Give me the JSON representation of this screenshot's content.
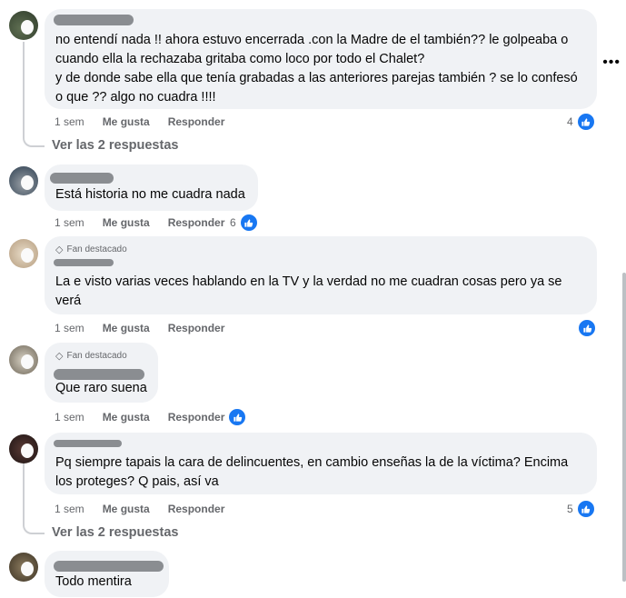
{
  "comments": [
    {
      "badge": "",
      "lines": [
        "no entendí nada !! ahora estuvo encerrada .con la Madre de el también?? le golpeaba o",
        "cuando ella la rechazaba gritaba como loco por todo el Chalet?",
        "y de donde sabe ella que tenía grabadas a las anteriores parejas también ? se lo confesó",
        "o que ?? algo no cuadra !!!!"
      ],
      "time": "1 sem",
      "like": "Me gusta",
      "reply": "Responder",
      "likes": "4",
      "replies": "Ver las 2 respuestas"
    },
    {
      "badge": "",
      "lines": [
        "Está historia no me cuadra nada"
      ],
      "time": "1 sem",
      "like": "Me gusta",
      "reply": "Responder",
      "likes": "6",
      "replies": ""
    },
    {
      "badge": "Fan destacado",
      "lines": [
        "La e visto varias veces hablando en la TV y la verdad no me cuadran cosas pero ya se",
        "verá"
      ],
      "time": "1 sem",
      "like": "Me gusta",
      "reply": "Responder",
      "likes": "",
      "replies": ""
    },
    {
      "badge": "Fan destacado",
      "lines": [
        "Que raro suena"
      ],
      "time": "1 sem",
      "like": "Me gusta",
      "reply": "Responder",
      "likes": "",
      "replies": ""
    },
    {
      "badge": "",
      "lines": [
        "Pq siempre tapais la cara de delincuentes, en cambio enseñas la de la víctima? Encima",
        "los proteges? Q pais, así va"
      ],
      "time": "1 sem",
      "like": "Me gusta",
      "reply": "Responder",
      "likes": "5",
      "replies": "Ver las 2 respuestas"
    },
    {
      "badge": "",
      "lines": [
        "Todo mentira"
      ],
      "time": "",
      "like": "",
      "reply": "",
      "likes": "",
      "replies": ""
    }
  ],
  "menu_icon": "more-options-icon",
  "like_icon": "thumbs-up-icon",
  "badge_icon": "diamond-icon",
  "colors": {
    "like_blue": "#1877f2",
    "bubble": "#f0f2f5",
    "meta_text": "#65676b"
  }
}
